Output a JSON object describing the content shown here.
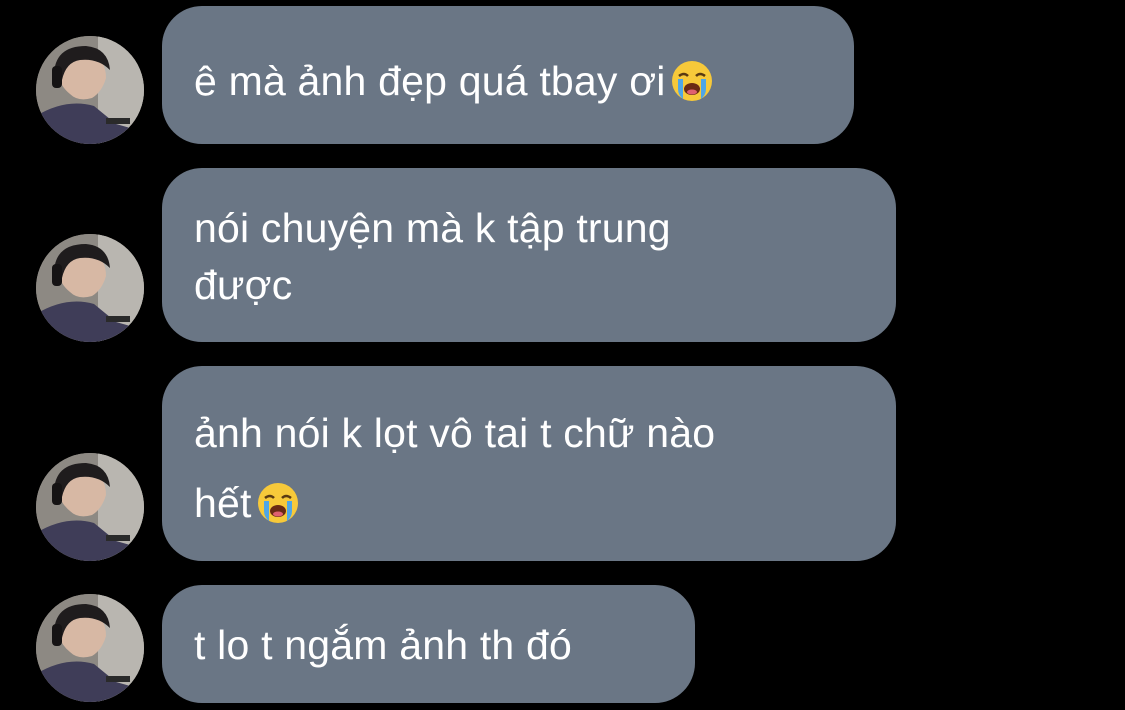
{
  "messages": [
    {
      "lines": [
        "ê mà ảnh đẹp quá tbay ơi"
      ],
      "emoji": "loudly-crying-face"
    },
    {
      "lines": [
        "nói chuyện mà k tập trung",
        "được"
      ],
      "emoji": ""
    },
    {
      "lines": [
        "ảnh nói k lọt vô tai t chữ nào",
        "hết"
      ],
      "emoji": "loudly-crying-face"
    },
    {
      "lines": [
        "t lo t ngắm ảnh th đó"
      ],
      "emoji": ""
    }
  ],
  "colors": {
    "background": "#000000",
    "bubble": "#6a7685",
    "text": "#ffffff"
  }
}
